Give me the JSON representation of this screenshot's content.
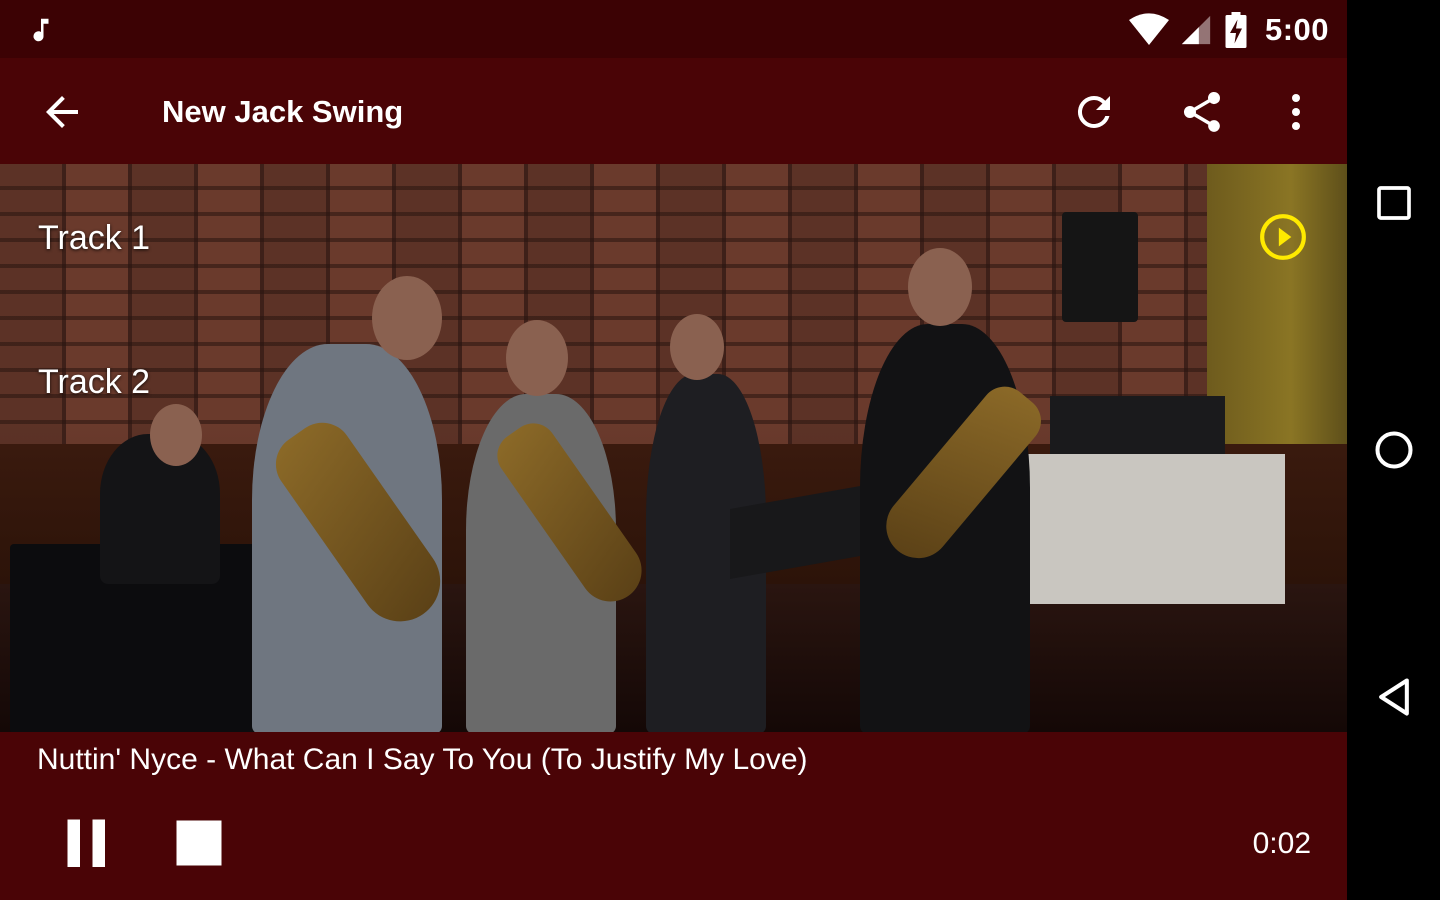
{
  "status_bar": {
    "time": "5:00",
    "icons": [
      "music-note-icon",
      "wifi-icon",
      "signal-icon",
      "battery-charging-icon"
    ]
  },
  "toolbar": {
    "title": "New Jack Swing",
    "icons": [
      "back-arrow-icon",
      "refresh-icon",
      "share-icon",
      "more-vert-icon"
    ]
  },
  "tracks": [
    {
      "label": "Track 1",
      "playing": true
    },
    {
      "label": "Track 2",
      "playing": false
    }
  ],
  "player": {
    "now_playing": "Nuttin' Nyce - What Can I Say To You (To Justify My Love)",
    "elapsed": "0:02",
    "controls": [
      "pause-icon",
      "stop-icon"
    ]
  },
  "nav_bar": {
    "buttons": [
      "recents-icon",
      "home-icon",
      "back-triangle-icon"
    ]
  },
  "colors": {
    "primary": "#4a0406",
    "status_bar": "#3c0204",
    "accent_play": "#ffea00",
    "nav_bar": "#000000"
  }
}
